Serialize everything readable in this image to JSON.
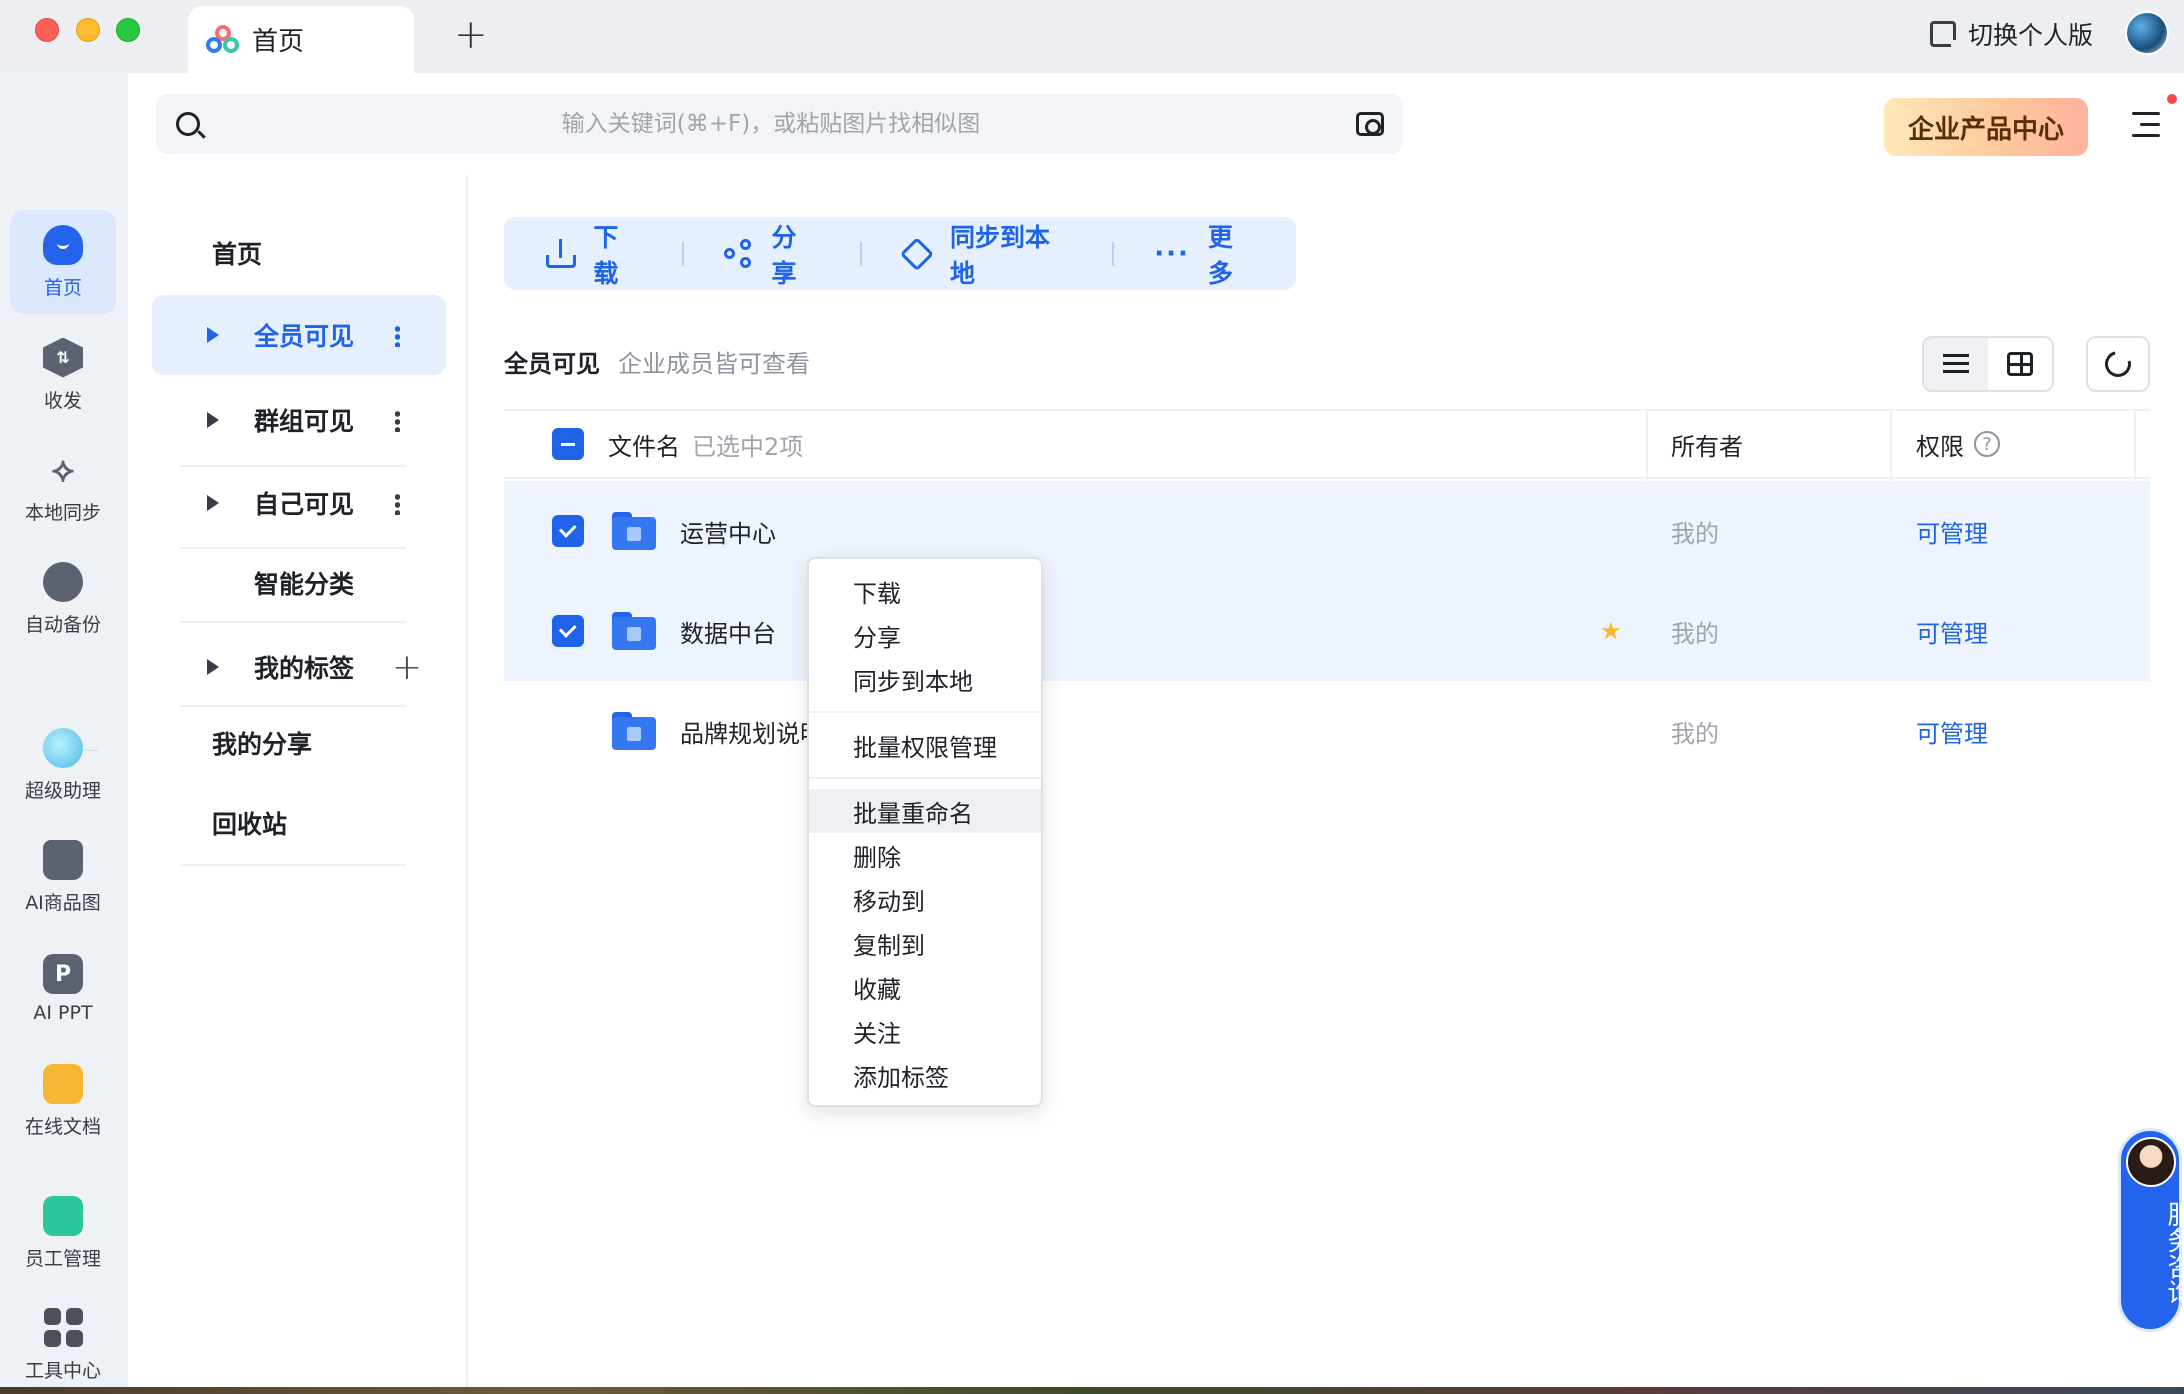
{
  "window": {
    "tab_title": "首页",
    "new_tab": "+",
    "switch_label": "切换个人版"
  },
  "rail": {
    "items": [
      {
        "label": "首页",
        "icon": "home-icon",
        "active": true
      },
      {
        "label": "收发",
        "icon": "transfer-icon"
      },
      {
        "label": "本地同步",
        "icon": "local-sync-icon"
      },
      {
        "label": "自动备份",
        "icon": "cloud-backup-icon"
      },
      {
        "label": "超级助理",
        "icon": "assistant-icon"
      },
      {
        "label": "AI商品图",
        "icon": "shopping-bag-icon"
      },
      {
        "label": "AI PPT",
        "icon": "ppt-icon",
        "glyph": "P"
      },
      {
        "label": "在线文档",
        "icon": "document-icon"
      },
      {
        "label": "员工管理",
        "icon": "staff-icon"
      },
      {
        "label": "工具中心",
        "icon": "tools-grid-icon"
      }
    ]
  },
  "search": {
    "placeholder": "输入关键词(⌘+F)，或粘贴图片找相似图"
  },
  "header": {
    "enterprise_button": "企业产品中心"
  },
  "sidenav": {
    "home": "首页",
    "items": [
      {
        "label": "全员可见",
        "selected": true
      },
      {
        "label": "群组可见"
      },
      {
        "label": "自己可见"
      },
      {
        "label": "智能分类"
      },
      {
        "label": "我的标签"
      },
      {
        "label": "我的分享"
      },
      {
        "label": "回收站"
      }
    ]
  },
  "toolbar": {
    "download": "下载",
    "share": "分享",
    "sync": "同步到本地",
    "more_dots": "···",
    "more": "更多"
  },
  "section": {
    "title": "全员可见",
    "subtitle": "企业成员皆可查看"
  },
  "table": {
    "col_name": "文件名",
    "selected_count": "已选中2项",
    "col_owner": "所有者",
    "col_permission": "权限",
    "help": "?",
    "rows": [
      {
        "name": "运营中心",
        "owner": "我的",
        "permission": "可管理",
        "selected": true,
        "starred": false
      },
      {
        "name": "数据中台",
        "owner": "我的",
        "permission": "可管理",
        "selected": true,
        "starred": true
      },
      {
        "name": "品牌规划说明",
        "owner": "我的",
        "permission": "可管理",
        "selected": false,
        "starred": false
      }
    ]
  },
  "context_menu": {
    "group1": [
      "下载",
      "分享",
      "同步到本地"
    ],
    "group2": [
      "批量权限管理"
    ],
    "group3": [
      "批量重命名",
      "删除",
      "移动到",
      "复制到",
      "收藏",
      "关注",
      "添加标签"
    ]
  },
  "service": {
    "label": "服务咨询"
  },
  "colors": {
    "accent": "#1f64e8",
    "selected_row": "#edf4fe",
    "enterprise_gradient_start": "#fde8b8",
    "enterprise_gradient_end": "#ffb2a0"
  }
}
